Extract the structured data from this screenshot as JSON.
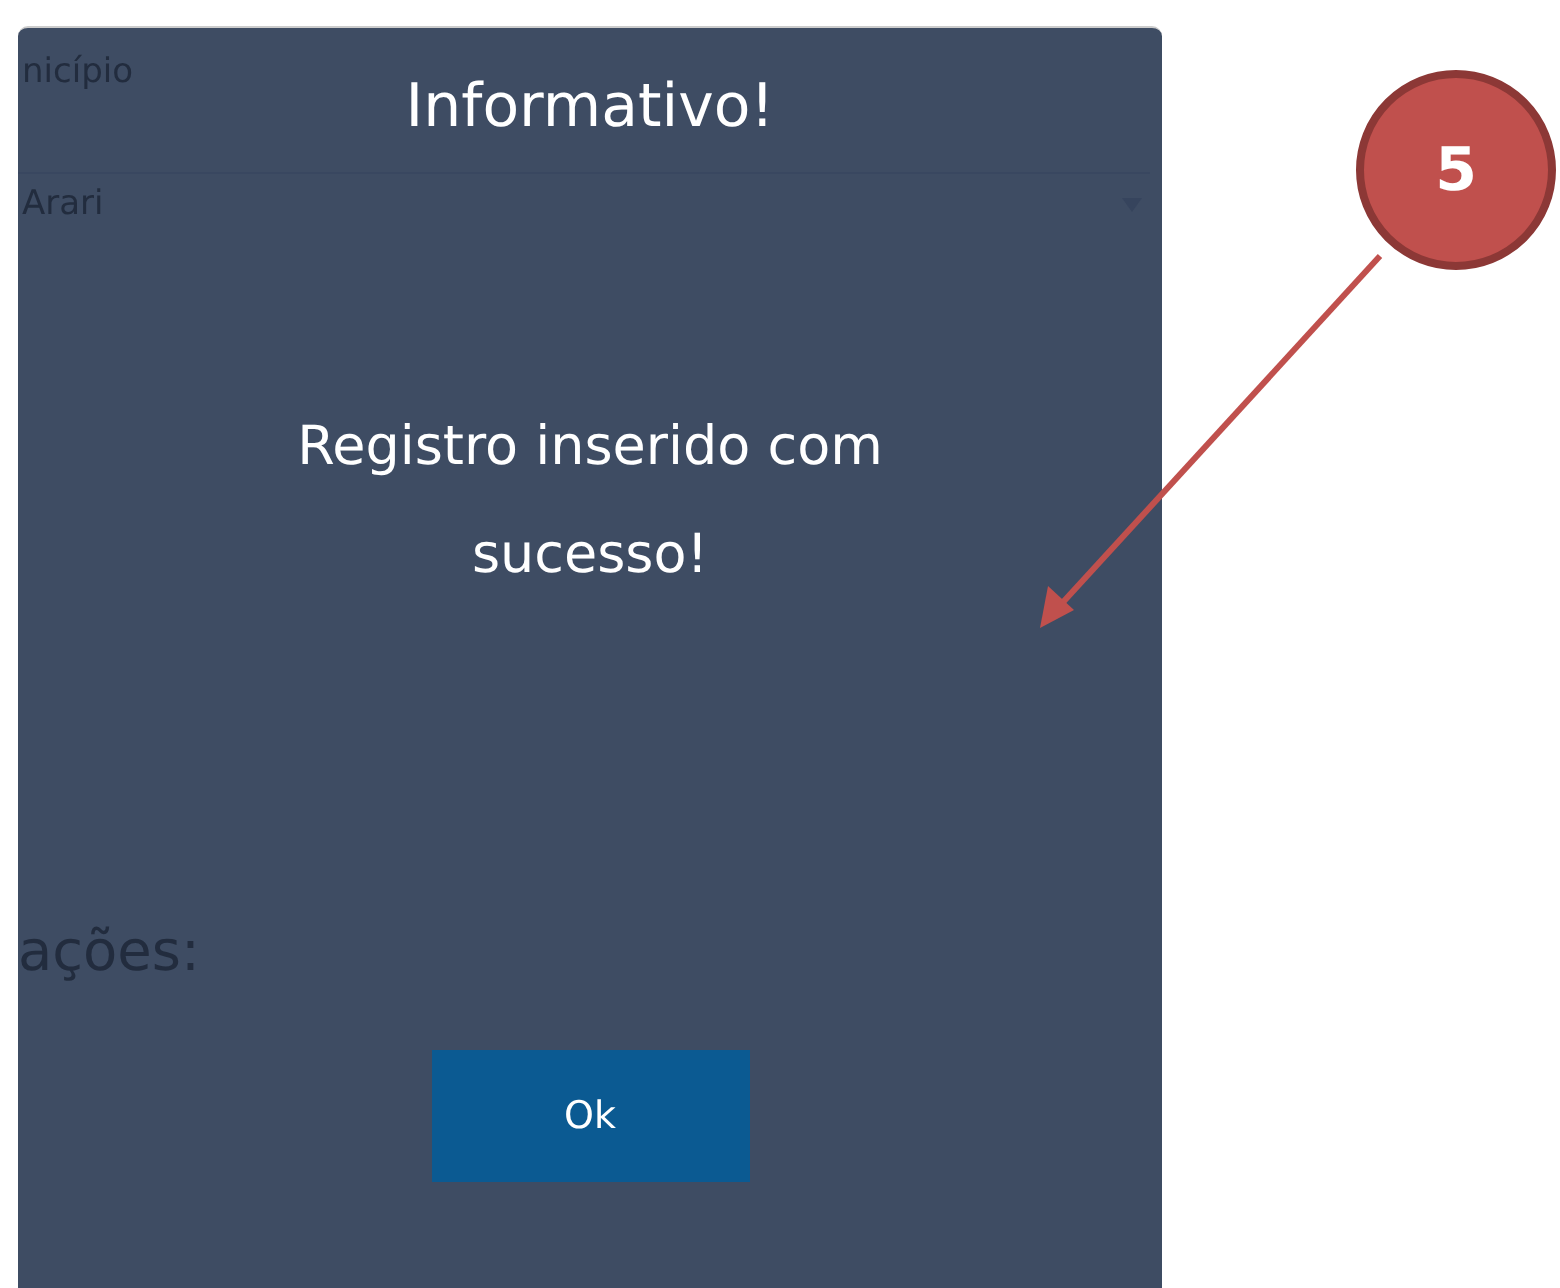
{
  "background_form": {
    "field_label": "nicípio",
    "field_value": "Arari",
    "section_heading": "ações:"
  },
  "dialog": {
    "title": "Informativo!",
    "message": "Registro inserido com sucesso!",
    "button": "Ok"
  },
  "callout": {
    "number": "5"
  }
}
